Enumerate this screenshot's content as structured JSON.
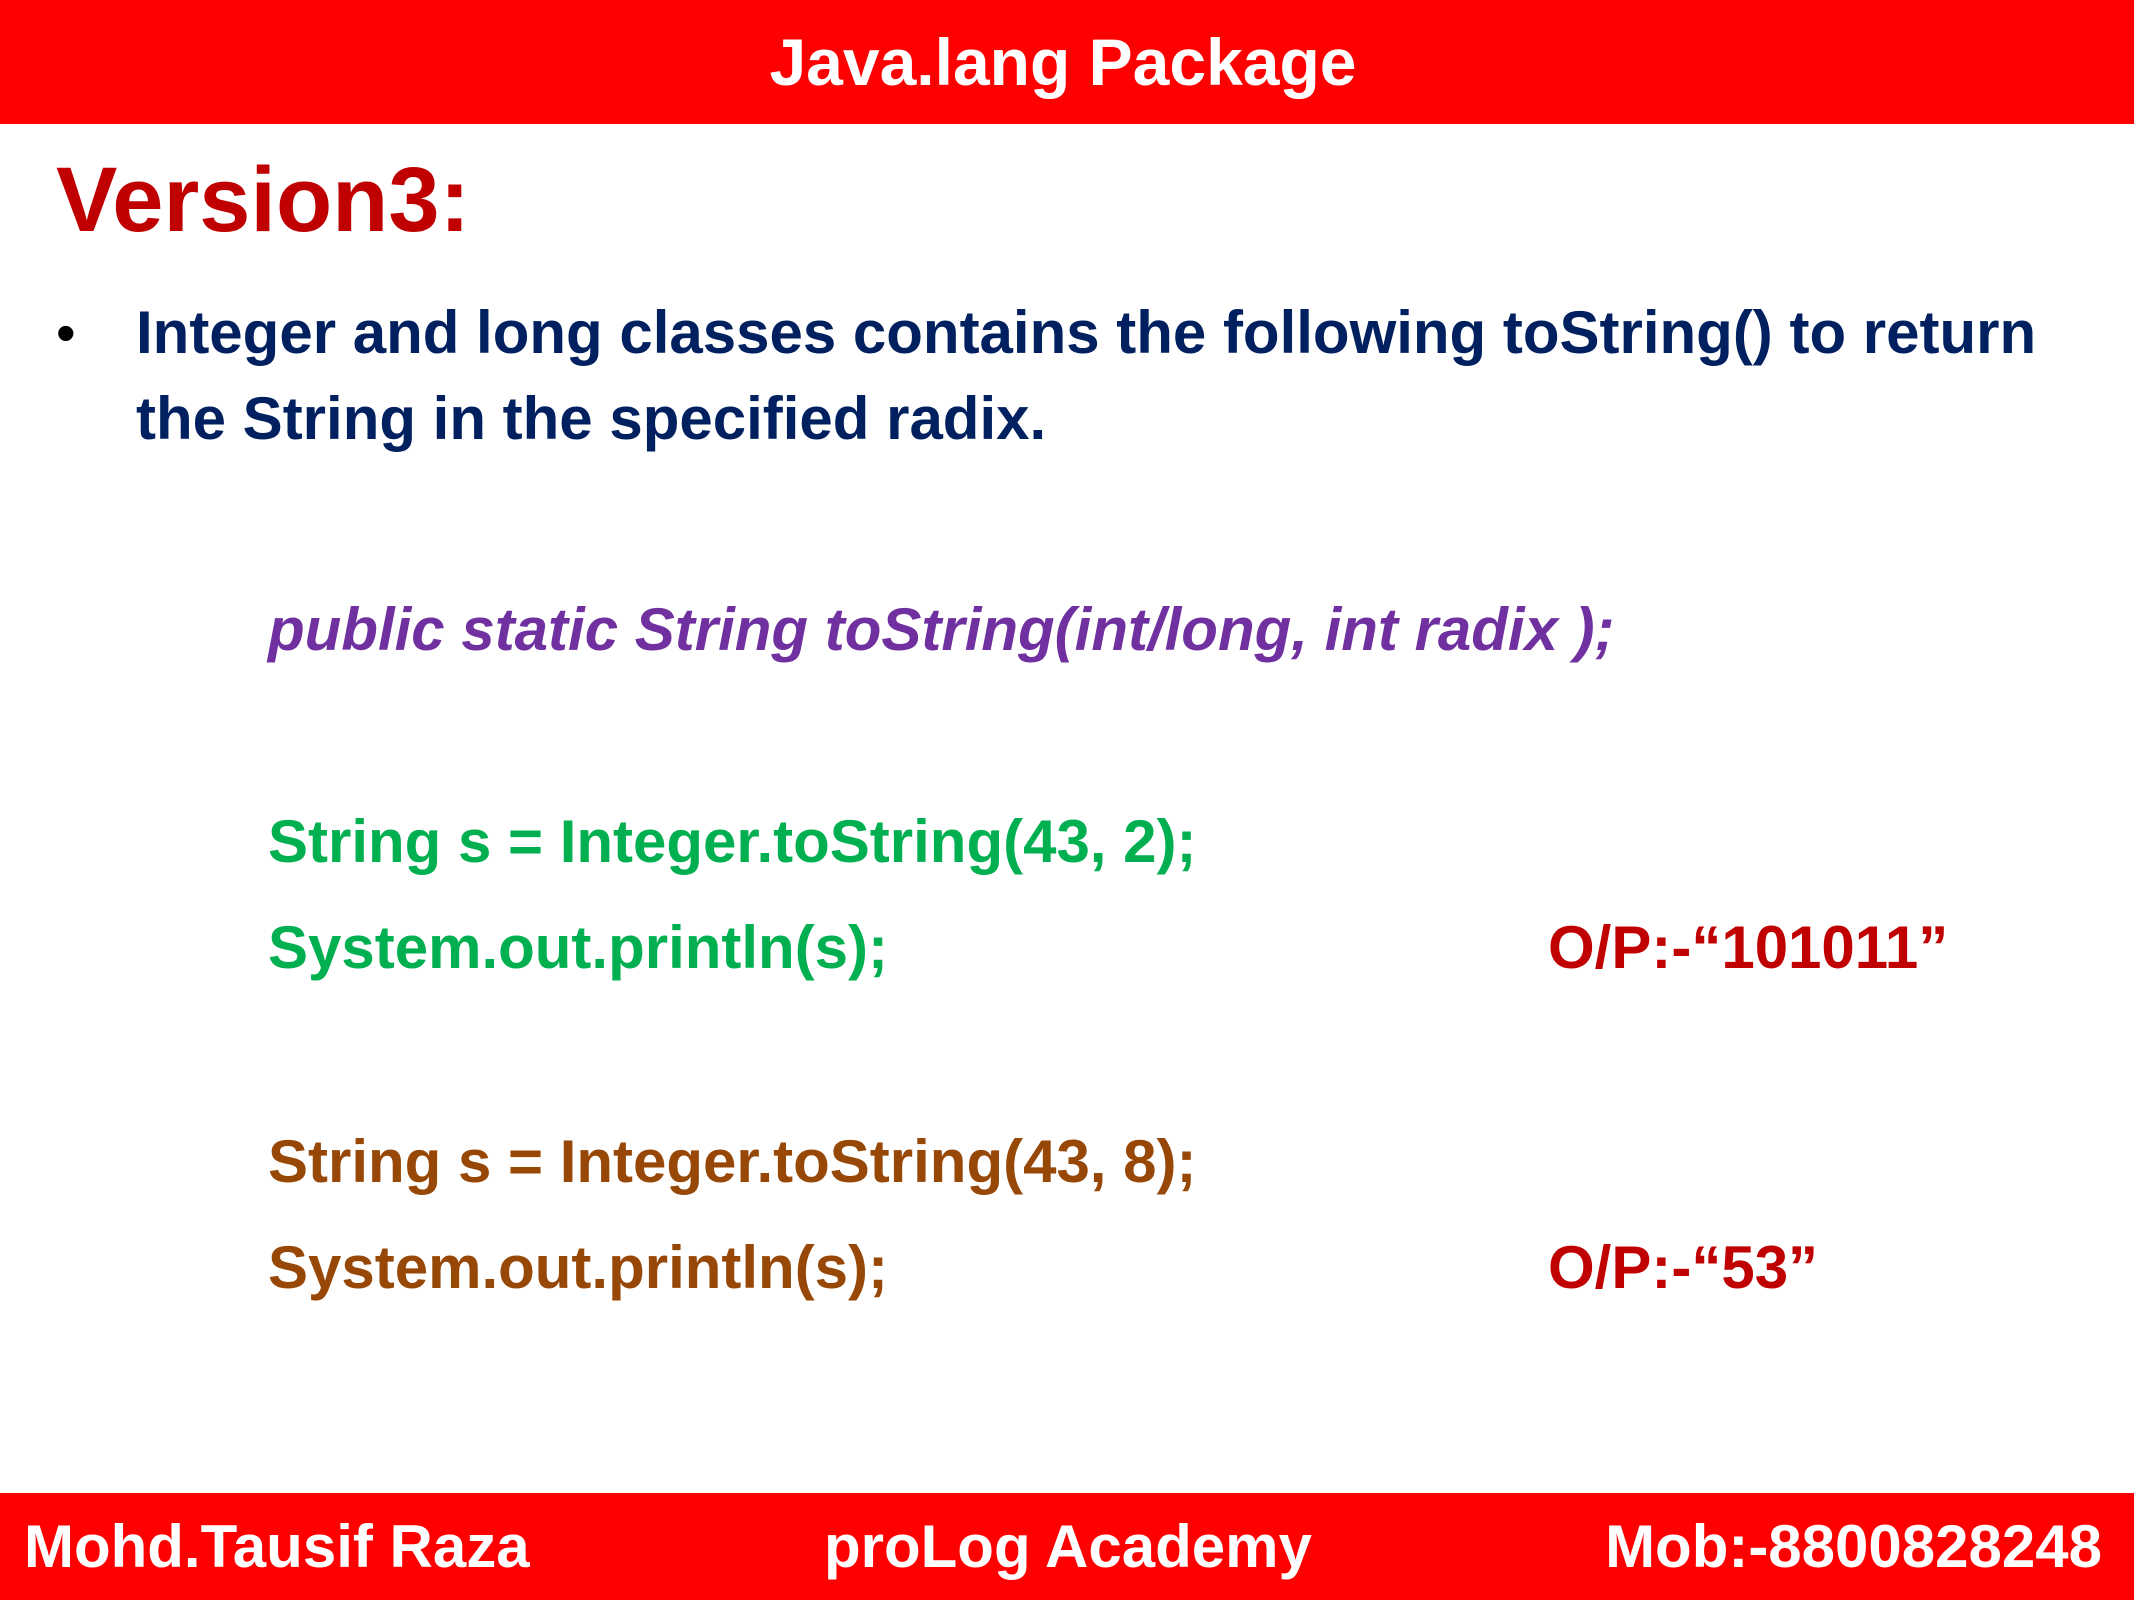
{
  "header": {
    "title": "Java.lang Package"
  },
  "heading": "Version3:",
  "bullet": {
    "text": "Integer and long classes contains the following toString() to return the String in the specified radix."
  },
  "signature": "public static String toString(int/long, int radix );",
  "examples": [
    {
      "line1": "String s = Integer.toString(43, 2);",
      "line2": "System.out.println(s);",
      "output": "O/P:-“101011”"
    },
    {
      "line1": "String s = Integer.toString(43, 8);",
      "line2": "System.out.println(s);",
      "output": "O/P:-“53”"
    }
  ],
  "footer": {
    "author": "Mohd.Tausif Raza",
    "academy": "proLog Academy",
    "mobile": "Mob:-8800828248"
  },
  "colors": {
    "bar": "#ff0000",
    "heading": "#c00000",
    "bullet_text": "#002060",
    "signature": "#7030a0",
    "example1": "#00b050",
    "example2": "#974706",
    "output": "#c00000"
  }
}
